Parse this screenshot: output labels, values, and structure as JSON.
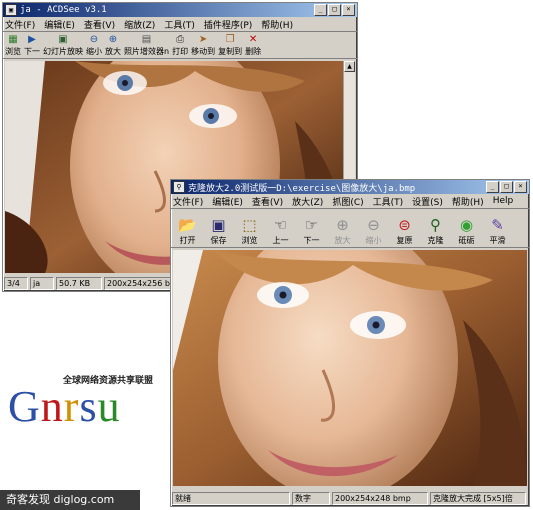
{
  "window1": {
    "title": "ja - ACDSee v3.1",
    "menu": [
      "文件(F)",
      "编辑(E)",
      "查看(V)",
      "缩放(Z)",
      "工具(T)",
      "插件程序(P)",
      "帮助(H)"
    ],
    "toolbar": [
      {
        "label": "浏览",
        "icon": "browse-icon",
        "glyph": "▦",
        "color": "#2a7a2a"
      },
      {
        "label": "下一",
        "icon": "next-icon",
        "glyph": "▶",
        "color": "#2050a0"
      },
      {
        "label": "幻灯片放映",
        "icon": "slideshow-icon",
        "glyph": "▣",
        "color": "#306030"
      },
      {
        "label": "缩小",
        "icon": "zoom-out-icon",
        "glyph": "⊖",
        "color": "#2050a0"
      },
      {
        "label": "放大",
        "icon": "zoom-in-icon",
        "glyph": "⊕",
        "color": "#2050a0"
      },
      {
        "label": "照片增效器n",
        "icon": "photo-enhancer-icon",
        "glyph": "▤",
        "color": "#505050"
      },
      {
        "label": "打印",
        "icon": "print-icon",
        "glyph": "⎙",
        "color": "#303030"
      },
      {
        "label": "移动到",
        "icon": "move-to-icon",
        "glyph": "➤",
        "color": "#a06020"
      },
      {
        "label": "复制到",
        "icon": "copy-to-icon",
        "glyph": "❐",
        "color": "#a06020"
      },
      {
        "label": "删除",
        "icon": "delete-icon",
        "glyph": "✕",
        "color": "#c00000"
      }
    ],
    "status": [
      "3/4",
      "ja",
      "50.7 KB",
      "200x254x256 bmp"
    ]
  },
  "window2": {
    "title": "克隆放大2.0测试版一D:\\exercise\\图像放大\\ja.bmp",
    "menu": [
      "文件(F)",
      "编辑(E)",
      "查看(V)",
      "放大(Z)",
      "抓图(C)",
      "工具(T)",
      "设置(S)",
      "帮助(H)",
      "Help"
    ],
    "toolbar": [
      {
        "label": "打开",
        "icon": "open-folder-icon",
        "glyph": "📂",
        "color": "#d0a000",
        "enabled": true
      },
      {
        "label": "保存",
        "icon": "save-icon",
        "glyph": "▣",
        "color": "#2a2a70",
        "enabled": true
      },
      {
        "label": "浏览",
        "icon": "browse-icon",
        "glyph": "⬚",
        "color": "#806000",
        "enabled": true
      },
      {
        "label": "上一",
        "icon": "previous-icon",
        "glyph": "☜",
        "color": "#404040",
        "enabled": true
      },
      {
        "label": "下一",
        "icon": "next-icon",
        "glyph": "☞",
        "color": "#404040",
        "enabled": true
      },
      {
        "label": "放大",
        "icon": "zoom-in-icon",
        "glyph": "⊕",
        "color": "#909090",
        "enabled": false
      },
      {
        "label": "缩小",
        "icon": "zoom-out-icon",
        "glyph": "⊖",
        "color": "#909090",
        "enabled": false
      },
      {
        "label": "复原",
        "icon": "restore-icon",
        "glyph": "⊜",
        "color": "#c02020",
        "enabled": true
      },
      {
        "label": "克隆",
        "icon": "clone-magnifier-icon",
        "glyph": "⚲",
        "color": "#206020",
        "enabled": true
      },
      {
        "label": "砥砺",
        "icon": "sharpen-icon",
        "glyph": "◉",
        "color": "#30a030",
        "enabled": true
      },
      {
        "label": "平滑",
        "icon": "smooth-brush-icon",
        "glyph": "✎",
        "color": "#6040a0",
        "enabled": true
      }
    ],
    "status": [
      "就绪",
      "数字",
      "200x254x248 bmp",
      "克隆放大完成 [5x5]倍"
    ]
  },
  "logo": {
    "tagline": "全球网络资源共享联盟",
    "letters": [
      "G",
      "n",
      "r",
      "s",
      "u"
    ],
    "colors": [
      "#2c4fa8",
      "#c01818",
      "#d09000",
      "#2c4fa8",
      "#2a8a2a"
    ]
  },
  "footer": {
    "text": "奇客发现 diglog.com"
  }
}
